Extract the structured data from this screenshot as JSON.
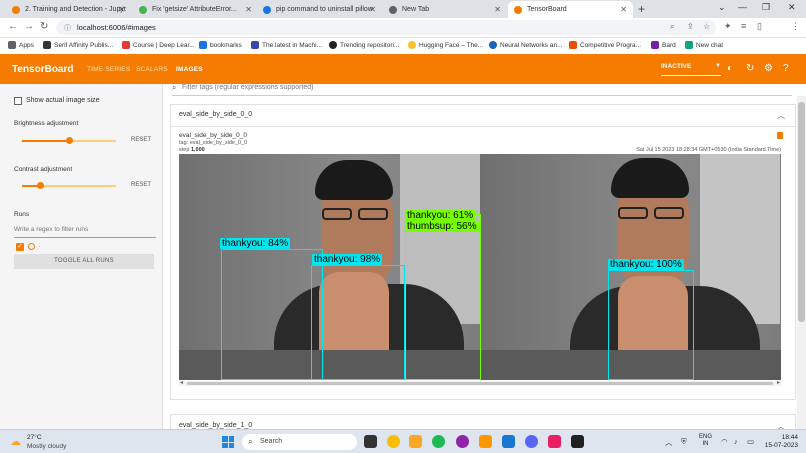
{
  "browser": {
    "tabs": [
      {
        "label": "2. Training and Detection - Jupyt",
        "color": "#f57c00",
        "active": false
      },
      {
        "label": "Fix 'getsize' AttributeError...",
        "color": "#4caf50",
        "active": false
      },
      {
        "label": "pip command to uninstall pillow",
        "color": "#1a73e8",
        "active": false
      },
      {
        "label": "New Tab",
        "color": "#5f6368",
        "active": false
      },
      {
        "label": "TensorBoard",
        "color": "#f57c00",
        "active": true
      }
    ],
    "url": "localhost:6006/#images",
    "bookmarks": [
      {
        "label": "Apps",
        "color": "#5f6368"
      },
      {
        "label": "Serif Affinity Publis...",
        "color": "#333333"
      },
      {
        "label": "Course | Deep Lear...",
        "color": "#e53935"
      },
      {
        "label": "bookmarks",
        "color": "#1a73e8"
      },
      {
        "label": "The latest in Machi...",
        "color": "#3949ab"
      },
      {
        "label": "Trending repositori...",
        "color": "#222222"
      },
      {
        "label": "Hugging Face – The...",
        "color": "#fbc02d"
      },
      {
        "label": "Neural Networks an...",
        "color": "#1565c0"
      },
      {
        "label": "Competitive Progra...",
        "color": "#e65100"
      },
      {
        "label": "Bard",
        "color": "#7b1fa2"
      },
      {
        "label": "New chat",
        "color": "#10a37f"
      }
    ]
  },
  "tensorboard": {
    "brand": "TensorBoard",
    "nav": [
      "TIME SERIES",
      "SCALARS",
      "IMAGES"
    ],
    "active_nav": "IMAGES",
    "status": "INACTIVE",
    "accent": "#f57c00"
  },
  "sidebar": {
    "show_actual_size": "Show actual image size",
    "brightness_label": "Brightness adjustment",
    "brightness_value": 0.5,
    "contrast_label": "Contrast adjustment",
    "contrast_value": 0.2,
    "reset": "RESET",
    "runs_label": "Runs",
    "regex_placeholder": "Write a regex to filter runs",
    "run_name": ".",
    "toggle_all": "TOGGLE ALL RUNS"
  },
  "main": {
    "filter_placeholder": "Filter tags (regular expressions supported)",
    "card": {
      "title": "eval_side_by_side_0_0",
      "name": "eval_side_by_side_0_0",
      "tag": "tag: eval_side_by_side_0_0",
      "step_label": "step",
      "step": "1,000",
      "timestamp": "Sat Jul 15 2023 18:28:34 GMT+0530 (India Standard Time)"
    },
    "detections": [
      {
        "label": "thankyou: 84%",
        "color": "#00e5ee"
      },
      {
        "label": "thankyou: 98%",
        "color": "#00e5ee"
      },
      {
        "label": "thankyou: 61%",
        "color": "#76ff03"
      },
      {
        "label": "thumbsup: 56%",
        "color": "#76ff03"
      },
      {
        "label": "thankyou: 100%",
        "color": "#00e5ee"
      }
    ],
    "next_card_title": "eval_side_by_side_1_0"
  },
  "taskbar": {
    "temperature": "27°C",
    "weather": "Mostly cloudy",
    "search": "Search",
    "lang_line1": "ENG",
    "lang_line2": "IN",
    "time": "18:44",
    "date": "15-07-2023"
  }
}
